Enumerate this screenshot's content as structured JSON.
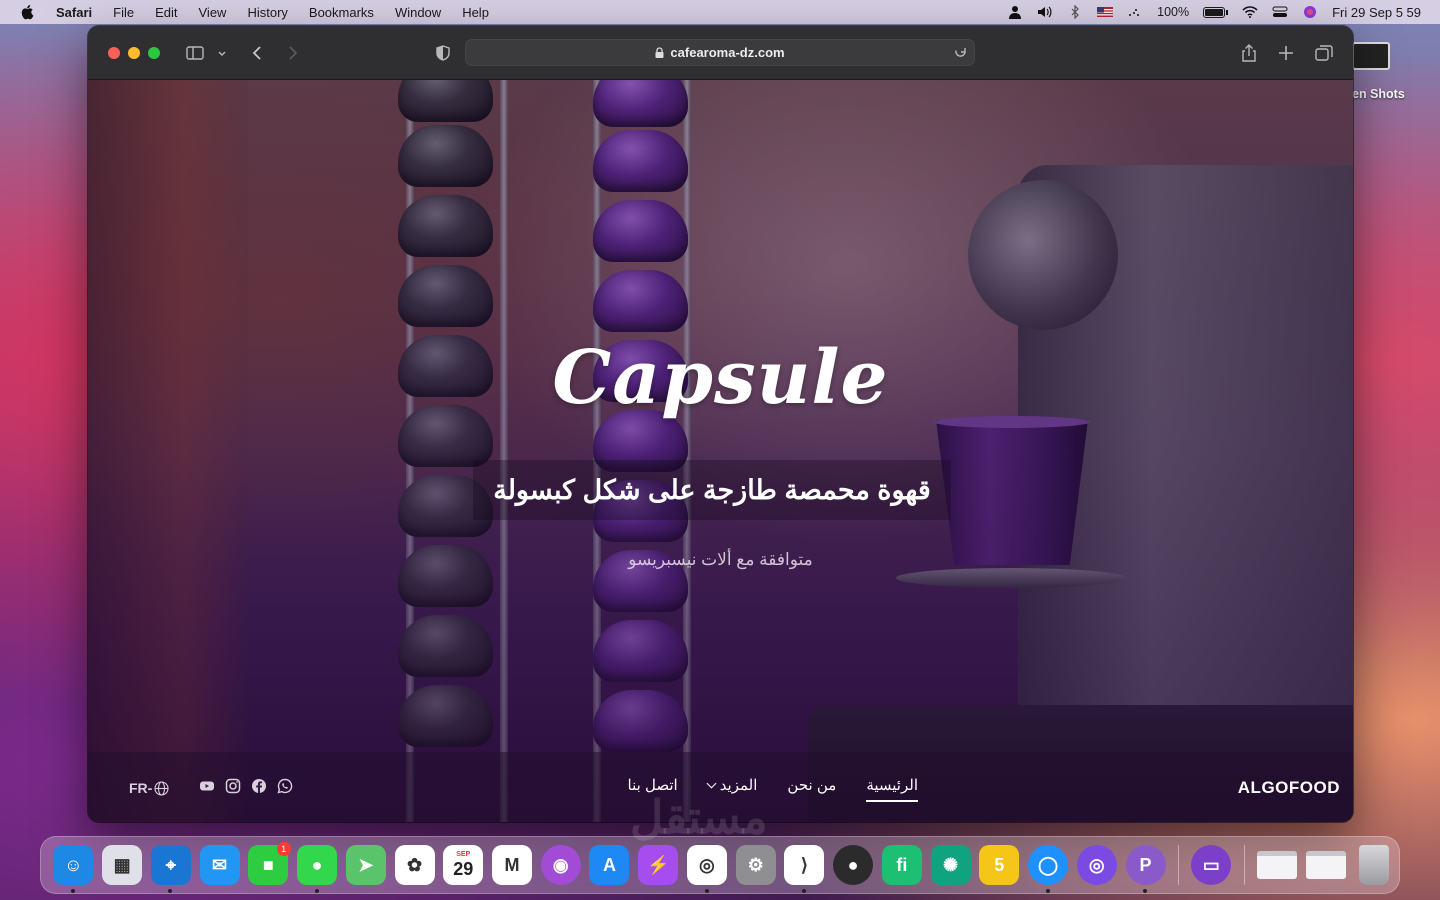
{
  "menubar": {
    "app_name": "Safari",
    "menus": [
      "File",
      "Edit",
      "View",
      "History",
      "Bookmarks",
      "Window",
      "Help"
    ],
    "battery_percent": "100%",
    "datetime": "Fri 29 Sep  5 59"
  },
  "browser": {
    "url": "cafearoma-dz.com"
  },
  "page": {
    "hero_script": "Capsule",
    "hero_title": "قهوة محمصة طازجة على شكل كبسولة",
    "hero_subtitle": "متوافقة مع ألات نيسبريسو",
    "brand": "ALGOFOOD",
    "nav": {
      "home": "الرئيسية",
      "about": "من نحن",
      "more": "المزيد",
      "contact": "اتصل بنا"
    },
    "lang_switch": "FR-"
  },
  "desktop": {
    "folder_label": "en Shots",
    "watermark": "مستقل"
  },
  "dock": {
    "apps": [
      {
        "name": "Finder",
        "icon": "finder-icon",
        "color": "#1e88e5",
        "glyph": "☺"
      },
      {
        "name": "Launchpad",
        "icon": "launchpad-icon",
        "color": "#e0e0e8",
        "glyph": "▦"
      },
      {
        "name": "Safari",
        "icon": "safari-icon",
        "color": "#1976d2",
        "glyph": "⌖"
      },
      {
        "name": "Mail",
        "icon": "mail-icon",
        "color": "#2196f3",
        "glyph": "✉"
      },
      {
        "name": "FaceTime",
        "icon": "facetime-icon",
        "color": "#2ecc40",
        "glyph": "■",
        "badge": "1"
      },
      {
        "name": "Messages",
        "icon": "messages-icon",
        "color": "#32d74b",
        "glyph": "●"
      },
      {
        "name": "Maps",
        "icon": "maps-icon",
        "color": "#5ac46b",
        "glyph": "➤"
      },
      {
        "name": "Photos",
        "icon": "photos-icon",
        "color": "#ffffff",
        "glyph": "✿"
      },
      {
        "name": "Calendar",
        "icon": "calendar-icon",
        "color": "#ffffff",
        "glyph": "29",
        "month": "SEP"
      },
      {
        "name": "Gmail",
        "icon": "gmail-icon",
        "color": "#ffffff",
        "glyph": "M"
      },
      {
        "name": "Podcasts",
        "icon": "podcasts-icon",
        "color": "#a24bd6",
        "glyph": "◉"
      },
      {
        "name": "App Store",
        "icon": "appstore-icon",
        "color": "#1e88f5",
        "glyph": "A"
      },
      {
        "name": "Messenger",
        "icon": "messenger-icon",
        "color": "#a64df0",
        "glyph": "⚡"
      },
      {
        "name": "Chrome",
        "icon": "chrome-icon",
        "color": "#ffffff",
        "glyph": "◎"
      },
      {
        "name": "System Settings",
        "icon": "settings-icon",
        "color": "#8e8e93",
        "glyph": "⚙"
      },
      {
        "name": "VS Code",
        "icon": "vscode-icon",
        "color": "#ffffff",
        "glyph": "⟩"
      },
      {
        "name": "Screen Recorder",
        "icon": "recorder-icon",
        "color": "#2b2b2b",
        "glyph": "●"
      },
      {
        "name": "Fiverr",
        "icon": "fiverr-icon",
        "color": "#1dbf73",
        "glyph": "fi"
      },
      {
        "name": "ChatGPT",
        "icon": "chatgpt-icon",
        "color": "#10a37f",
        "glyph": "✺"
      },
      {
        "name": "Five",
        "icon": "five-icon",
        "color": "#f5c518",
        "glyph": "5"
      },
      {
        "name": "Camo",
        "icon": "camo-icon",
        "color": "#1e90ff",
        "glyph": "◯"
      },
      {
        "name": "Proxyman",
        "icon": "proxyman-icon",
        "color": "#7b4ae2",
        "glyph": "◎"
      },
      {
        "name": "Patreon",
        "icon": "patreon-icon",
        "color": "#8a5ac8",
        "glyph": "P"
      },
      {
        "name": "Drive",
        "icon": "drive-icon",
        "color": "#7c3fc9",
        "glyph": "▭"
      }
    ],
    "recents": [
      {
        "name": "Chrome window",
        "icon": "window-thumb-icon"
      },
      {
        "name": "Preview window",
        "icon": "window-thumb-icon"
      },
      {
        "name": "Trash",
        "icon": "trash-icon"
      }
    ]
  }
}
